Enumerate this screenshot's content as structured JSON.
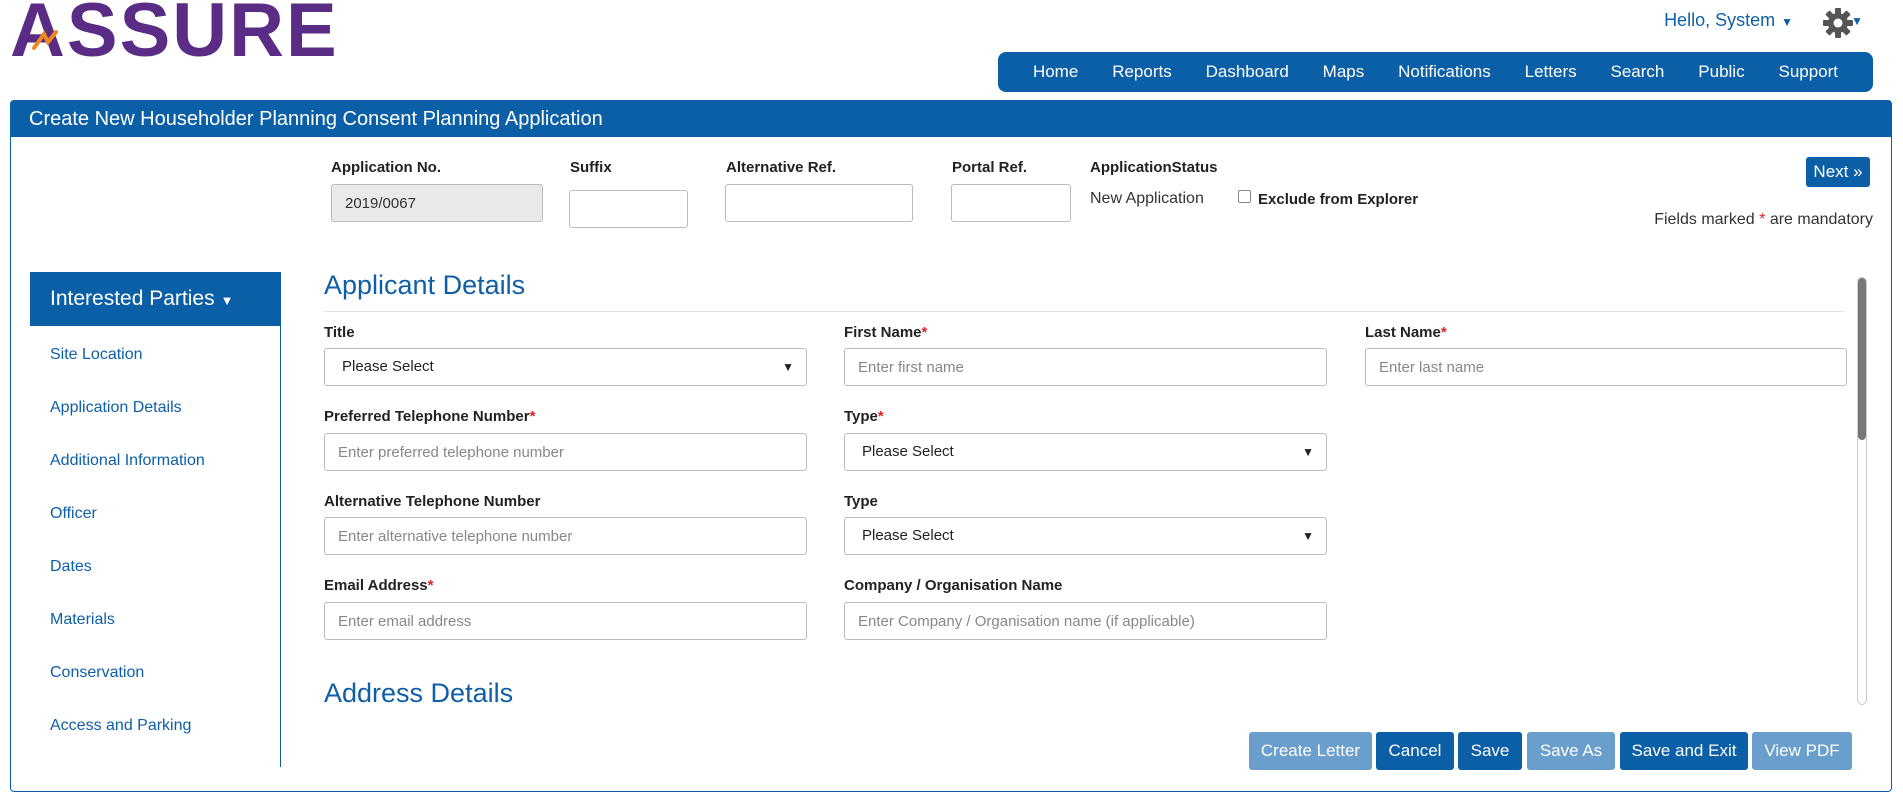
{
  "brand": {
    "logo_text": "ASSURE"
  },
  "user": {
    "greeting": "Hello, System"
  },
  "nav": [
    {
      "label": "Home"
    },
    {
      "label": "Reports"
    },
    {
      "label": "Dashboard"
    },
    {
      "label": "Maps"
    },
    {
      "label": "Notifications"
    },
    {
      "label": "Letters"
    },
    {
      "label": "Search"
    },
    {
      "label": "Public"
    },
    {
      "label": "Support"
    }
  ],
  "panel": {
    "title": "Create New Householder Planning Consent Planning Application"
  },
  "app_header": {
    "application_no_label": "Application No.",
    "application_no_value": "2019/0067",
    "suffix_label": "Suffix",
    "alt_ref_label": "Alternative Ref.",
    "portal_ref_label": "Portal Ref.",
    "status_label": "ApplicationStatus",
    "status_value": "New Application",
    "exclude_label": "Exclude from Explorer",
    "next_label": "Next »",
    "mandatory_prefix": "Fields marked",
    "mandatory_star": "*",
    "mandatory_suffix": "are mandatory"
  },
  "sidebar": {
    "header": "Interested Parties",
    "items": [
      {
        "label": "Site Location"
      },
      {
        "label": "Application Details"
      },
      {
        "label": "Additional Information"
      },
      {
        "label": "Officer"
      },
      {
        "label": "Dates"
      },
      {
        "label": "Materials"
      },
      {
        "label": "Conservation"
      },
      {
        "label": "Access and Parking"
      }
    ]
  },
  "applicant": {
    "section_title": "Applicant Details",
    "title_label": "Title",
    "title_value": "Please Select",
    "first_name_label": "First Name",
    "first_name_placeholder": "Enter first name",
    "last_name_label": "Last Name",
    "last_name_placeholder": "Enter last name",
    "pref_tel_label": "Preferred Telephone Number",
    "pref_tel_placeholder": "Enter preferred telephone number",
    "type1_label": "Type",
    "type1_value": "Please Select",
    "alt_tel_label": "Alternative Telephone Number",
    "alt_tel_placeholder": "Enter alternative telephone number",
    "type2_label": "Type",
    "type2_value": "Please Select",
    "email_label": "Email Address",
    "email_placeholder": "Enter email address",
    "company_label": "Company / Organisation Name",
    "company_placeholder": "Enter Company / Organisation name (if applicable)",
    "required_mark": "*"
  },
  "address": {
    "section_title": "Address Details"
  },
  "actions": {
    "create_letter": "Create Letter",
    "cancel": "Cancel",
    "save": "Save",
    "save_as": "Save As",
    "save_exit": "Save and Exit",
    "view_pdf": "View PDF"
  },
  "colors": {
    "primary": "#0a5fa7",
    "light_button": "#6a9ecc",
    "logo_purple": "#5b2c86",
    "logo_orange": "#f08a1c",
    "required": "#dd2222"
  },
  "icons": {
    "gear": "gear-icon",
    "caret": "caret-down-icon",
    "select_arrow": "triangle-down-icon"
  }
}
